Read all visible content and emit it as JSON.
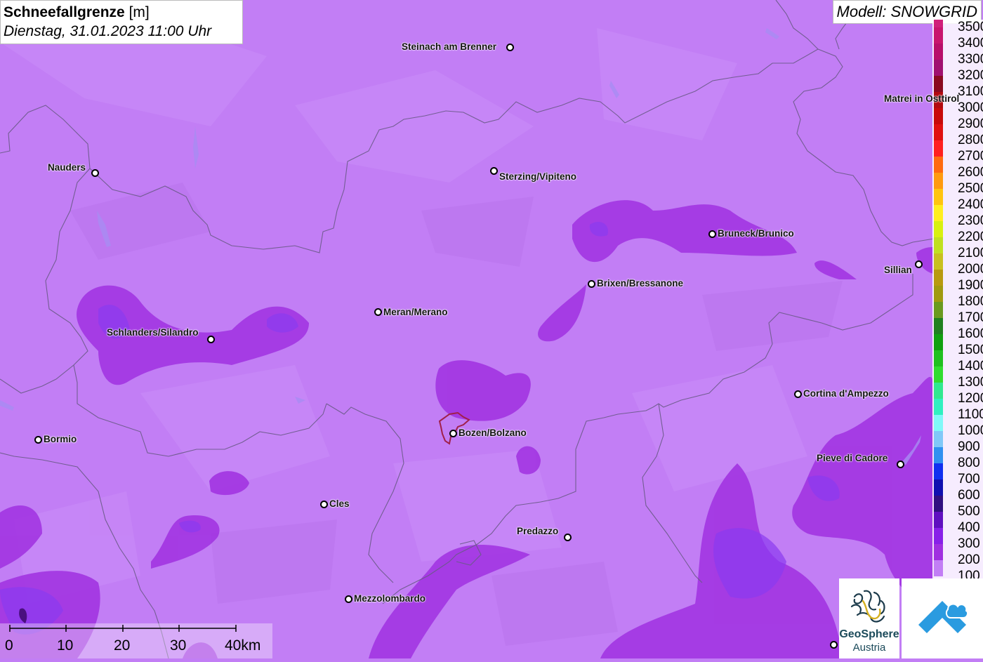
{
  "header": {
    "title": "Schneefallgrenze",
    "unit": "[m]",
    "datetime": "Dienstag, 31.01.2023 11:00 Uhr",
    "model_label": "Modell: SNOWGRID"
  },
  "legend": {
    "levels": [
      {
        "value": "3500",
        "color": "#d0207a"
      },
      {
        "value": "3400",
        "color": "#c8156e"
      },
      {
        "value": "3300",
        "color": "#b80e6a"
      },
      {
        "value": "3200",
        "color": "#a01070"
      },
      {
        "value": "3100",
        "color": "#8a0a20"
      },
      {
        "value": "3000",
        "color": "#b20a10"
      },
      {
        "value": "2900",
        "color": "#c80a0a"
      },
      {
        "value": "2800",
        "color": "#e01010"
      },
      {
        "value": "2700",
        "color": "#ff2020"
      },
      {
        "value": "2600",
        "color": "#ff6a10"
      },
      {
        "value": "2500",
        "color": "#ff9a10"
      },
      {
        "value": "2400",
        "color": "#ffc410"
      },
      {
        "value": "2300",
        "color": "#ffee20"
      },
      {
        "value": "2200",
        "color": "#d8f010"
      },
      {
        "value": "2100",
        "color": "#c0e020"
      },
      {
        "value": "2000",
        "color": "#c8c020"
      },
      {
        "value": "1900",
        "color": "#b89a10"
      },
      {
        "value": "1800",
        "color": "#a09a10"
      },
      {
        "value": "1700",
        "color": "#6a9a20"
      },
      {
        "value": "1600",
        "color": "#208020"
      },
      {
        "value": "1500",
        "color": "#10a010"
      },
      {
        "value": "1400",
        "color": "#20c020"
      },
      {
        "value": "1300",
        "color": "#30dc30"
      },
      {
        "value": "1200",
        "color": "#30e890"
      },
      {
        "value": "1100",
        "color": "#30f0c0"
      },
      {
        "value": "1000",
        "color": "#80f8f8"
      },
      {
        "value": "900",
        "color": "#80c8f8"
      },
      {
        "value": "800",
        "color": "#3090f0"
      },
      {
        "value": "700",
        "color": "#1030f0"
      },
      {
        "value": "600",
        "color": "#1010b0"
      },
      {
        "value": "500",
        "color": "#301080"
      },
      {
        "value": "400",
        "color": "#6010c0"
      },
      {
        "value": "300",
        "color": "#8820e8"
      },
      {
        "value": "200",
        "color": "#a030e0"
      },
      {
        "value": "100",
        "color": "#c27ef5"
      }
    ]
  },
  "cities": [
    {
      "name": "Steinach am Brenner"
    },
    {
      "name": "Matrei in Osttirol"
    },
    {
      "name": "Nauders"
    },
    {
      "name": "Sterzing/Vipiteno"
    },
    {
      "name": "Bruneck/Brunico"
    },
    {
      "name": "Sillian"
    },
    {
      "name": "Brixen/Bressanone"
    },
    {
      "name": "Meran/Merano"
    },
    {
      "name": "Schlanders/Silandro"
    },
    {
      "name": "Cortina d'Ampezzo"
    },
    {
      "name": "Bormio"
    },
    {
      "name": "Bozen/Bolzano"
    },
    {
      "name": "Pieve di Cadore"
    },
    {
      "name": "Cles"
    },
    {
      "name": "Predazzo"
    },
    {
      "name": "Mezzolombardo"
    }
  ],
  "scale_bar": {
    "labels": [
      "0",
      "10",
      "20",
      "30",
      "40km"
    ]
  },
  "logos": {
    "geosphere_line1": "GeoSphere",
    "geosphere_line2": "Austria"
  },
  "colors": {
    "base": "#c27ef5",
    "level_200": "#a030e0",
    "level_300": "#8a3af0",
    "border": "#6a5a88"
  }
}
